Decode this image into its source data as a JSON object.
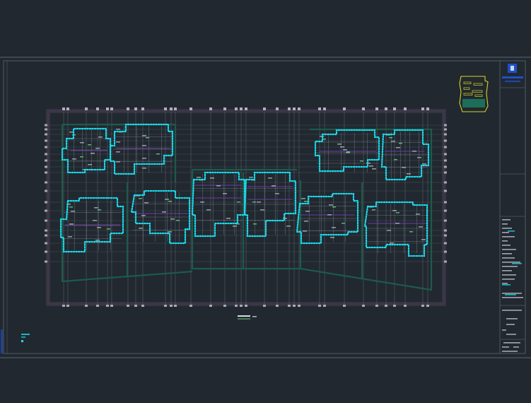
{
  "viewer": {
    "background": "#212830"
  },
  "drawing": {
    "colors": {
      "sheet_frame": "#515a64",
      "outer_boundary": "#5e4a66",
      "grid_line": "#7a8088",
      "structure": "#1d5a4c",
      "room_outline": "#9aa3ad",
      "dotted_wall": "#19dcec",
      "beam": "#6f3aa8",
      "annotation": "#6ed08a",
      "text_mark": "#d9dde2",
      "key_plan_outline": "#d4d61f",
      "title_logo": "#1f4fc4"
    },
    "sheet": {
      "type": "architectural floor plan",
      "units_count_left_block": 4,
      "units_count_middle_block": 2,
      "units_count_right_block": 4
    },
    "title_block": {
      "logo_icon": "building-logo-icon"
    },
    "key_plan": {
      "icon": "key-plan-icon"
    },
    "legend": {
      "icon": "legend-icon"
    }
  }
}
